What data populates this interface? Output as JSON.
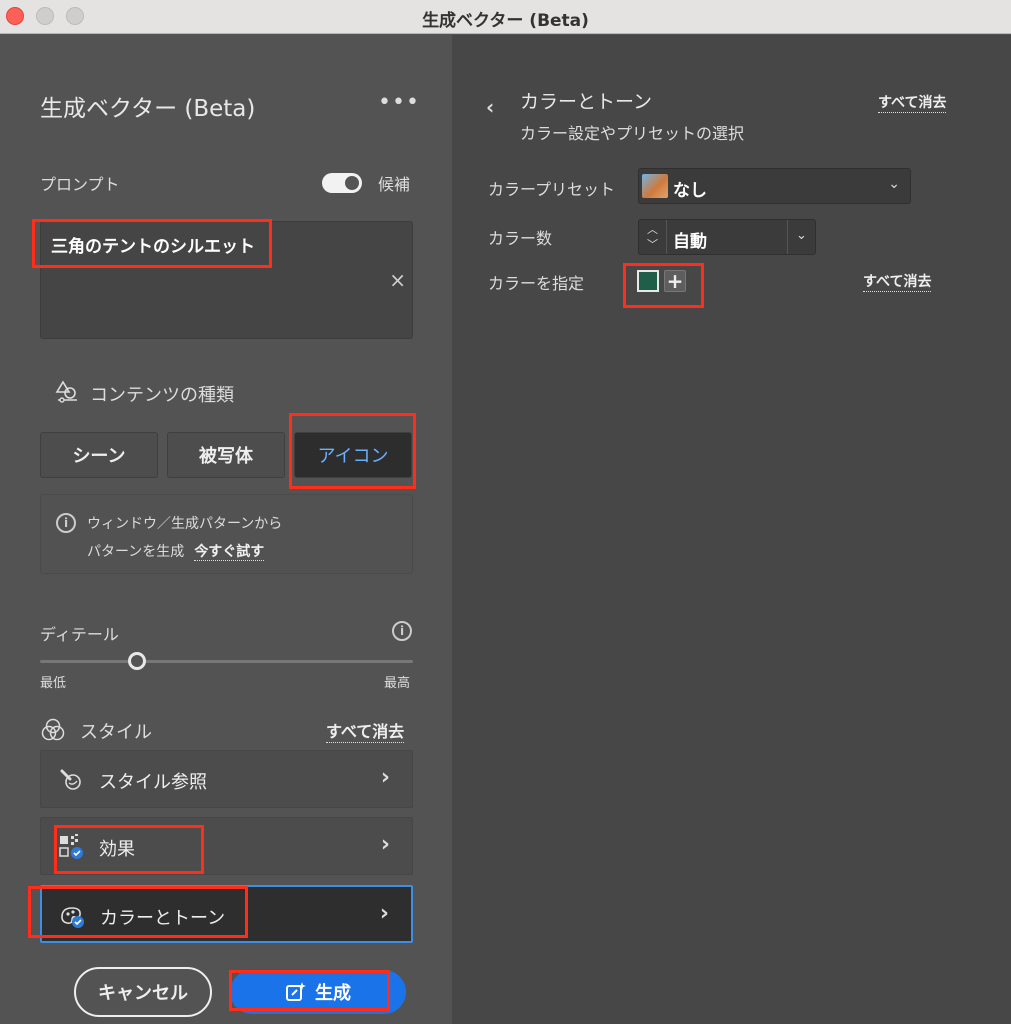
{
  "window": {
    "title": "生成ベクター (Beta)"
  },
  "panel": {
    "title": "生成ベクター (Beta)",
    "more_icon": "ellipsis-icon",
    "prompt": {
      "label": "プロンプト",
      "toggle_label": "候補",
      "toggle_on": true,
      "value": "三角のテントのシルエット",
      "clear_symbol": "×"
    },
    "content_type": {
      "label": "コンテンツの種類",
      "options": [
        "シーン",
        "被写体",
        "アイコン"
      ],
      "selected": "アイコン"
    },
    "info": {
      "line1": "ウィンドウ／生成パターンから",
      "line2": "パターンを生成",
      "link": "今すぐ試す"
    },
    "detail": {
      "label": "ディテール",
      "min_label": "最低",
      "max_label": "最高",
      "value_fraction": 0.26
    },
    "style": {
      "label": "スタイル",
      "clear_all": "すべて消去",
      "rows": [
        {
          "label": "スタイル参照",
          "icon": "style-reference-icon"
        },
        {
          "label": "効果",
          "icon": "effects-icon"
        },
        {
          "label": "カラーとトーン",
          "icon": "color-tone-icon"
        }
      ]
    },
    "buttons": {
      "cancel": "キャンセル",
      "generate": "生成"
    }
  },
  "color_tone_panel": {
    "title": "カラーとトーン",
    "subtitle": "カラー設定やプリセットの選択",
    "clear_all": "すべて消去",
    "preset": {
      "label": "カラープリセット",
      "value": "なし"
    },
    "count": {
      "label": "カラー数",
      "value": "自動"
    },
    "specify": {
      "label": "カラーを指定",
      "clear_all": "すべて消去",
      "swatch_color": "#1f5e49"
    }
  },
  "colors": {
    "accent": "#1a73e8",
    "highlight": "#ff2d1a",
    "selected_text": "#6bb0ff"
  }
}
